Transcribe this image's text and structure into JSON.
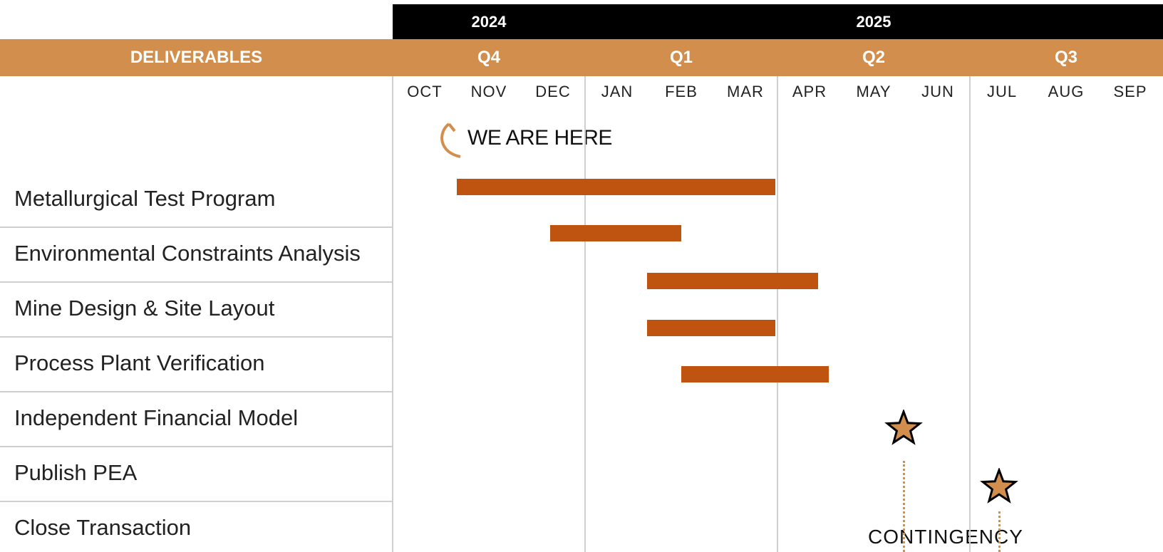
{
  "header": {
    "deliverables_label": "DELIVERABLES",
    "years": [
      "2024",
      "2025"
    ],
    "quarters": [
      "Q4",
      "Q1",
      "Q2",
      "Q3"
    ],
    "months": [
      "OCT",
      "NOV",
      "DEC",
      "JAN",
      "FEB",
      "MAR",
      "APR",
      "MAY",
      "JUN",
      "JUL",
      "AUG",
      "SEP"
    ]
  },
  "annotations": {
    "current_marker": "WE ARE HERE",
    "contingency": "CONTINGENCY"
  },
  "colors": {
    "bar": "#BF5410",
    "accent": "#D28E4C",
    "year_band": "#000000"
  },
  "chart_data": {
    "type": "gantt",
    "x_axis": "months OCT 2024 – SEP 2025",
    "tasks": [
      {
        "name": "Metallurgical Test Program",
        "start": "2024-11-01",
        "end": "2025-03-31"
      },
      {
        "name": "Environmental Constraints Analysis",
        "start": "2024-12-15",
        "end": "2025-02-15"
      },
      {
        "name": "Mine Design & Site Layout",
        "start": "2025-01-31",
        "end": "2025-04-20"
      },
      {
        "name": "Process Plant Verification",
        "start": "2025-01-31",
        "end": "2025-03-31"
      },
      {
        "name": "Independent Financial Model",
        "start": "2025-02-15",
        "end": "2025-04-25"
      },
      {
        "name": "Publish PEA",
        "milestone": "2025-05-31"
      },
      {
        "name": "Close Transaction",
        "milestone": "2025-07-15"
      }
    ]
  }
}
